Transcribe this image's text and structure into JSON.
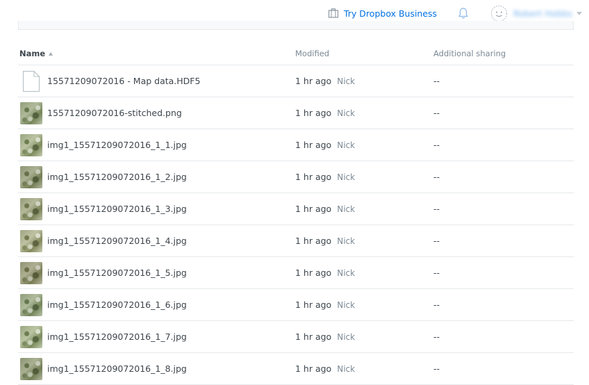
{
  "topbar": {
    "try_business": "Try Dropbox Business",
    "account_name": "Robert Hobbs"
  },
  "columns": {
    "name": "Name",
    "modified": "Modified",
    "sharing": "Additional sharing"
  },
  "files": [
    {
      "name": "15571209072016 - Map data.HDF5",
      "time": "1 hr ago",
      "user": "Nick",
      "sharing": "--",
      "kind": "file"
    },
    {
      "name": "15571209072016-stitched.png",
      "time": "1 hr ago",
      "user": "Nick",
      "sharing": "--",
      "kind": "image"
    },
    {
      "name": "img1_15571209072016_1_1.jpg",
      "time": "1 hr ago",
      "user": "Nick",
      "sharing": "--",
      "kind": "image"
    },
    {
      "name": "img1_15571209072016_1_2.jpg",
      "time": "1 hr ago",
      "user": "Nick",
      "sharing": "--",
      "kind": "image"
    },
    {
      "name": "img1_15571209072016_1_3.jpg",
      "time": "1 hr ago",
      "user": "Nick",
      "sharing": "--",
      "kind": "image"
    },
    {
      "name": "img1_15571209072016_1_4.jpg",
      "time": "1 hr ago",
      "user": "Nick",
      "sharing": "--",
      "kind": "image"
    },
    {
      "name": "img1_15571209072016_1_5.jpg",
      "time": "1 hr ago",
      "user": "Nick",
      "sharing": "--",
      "kind": "image"
    },
    {
      "name": "img1_15571209072016_1_6.jpg",
      "time": "1 hr ago",
      "user": "Nick",
      "sharing": "--",
      "kind": "image"
    },
    {
      "name": "img1_15571209072016_1_7.jpg",
      "time": "1 hr ago",
      "user": "Nick",
      "sharing": "--",
      "kind": "image"
    },
    {
      "name": "img1_15571209072016_1_8.jpg",
      "time": "1 hr ago",
      "user": "Nick",
      "sharing": "--",
      "kind": "image"
    }
  ]
}
